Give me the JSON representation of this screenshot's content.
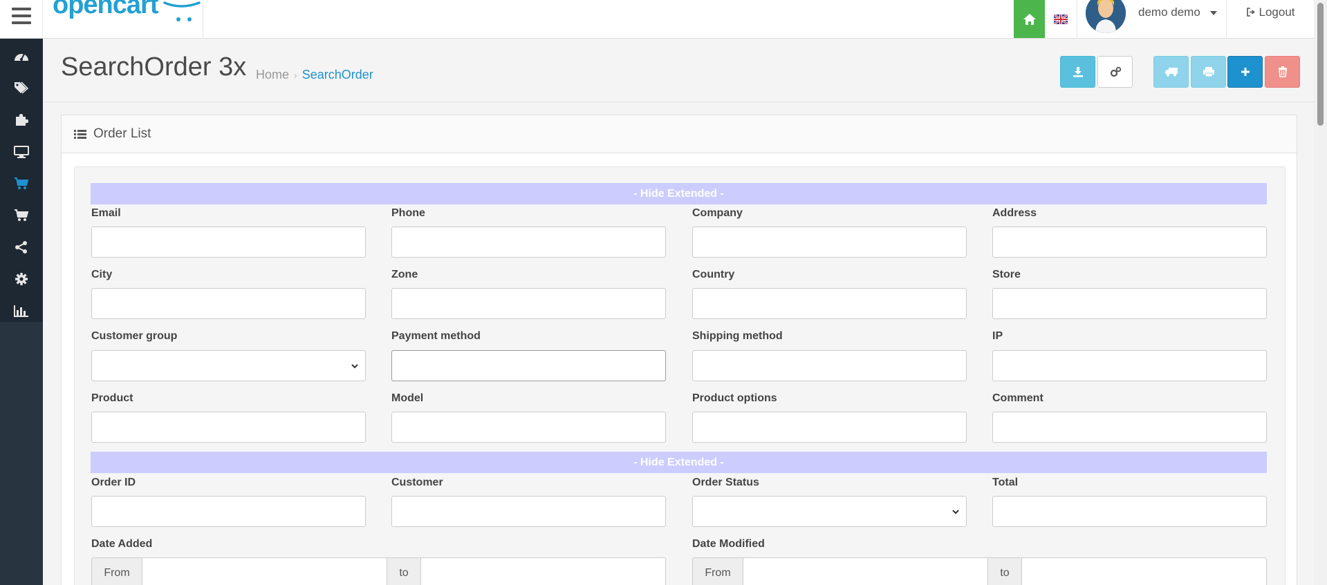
{
  "header": {
    "logo_text": "opencart",
    "user_name": "demo demo",
    "logout_label": "Logout"
  },
  "sidebar": {
    "items": [
      {
        "icon": "dashboard-icon"
      },
      {
        "icon": "tags-icon"
      },
      {
        "icon": "puzzle-icon"
      },
      {
        "icon": "desktop-icon"
      },
      {
        "icon": "shopping-cart-icon"
      },
      {
        "icon": "cart-plus-icon"
      },
      {
        "icon": "share-icon"
      },
      {
        "icon": "cog-icon"
      },
      {
        "icon": "bar-chart-icon"
      }
    ]
  },
  "page": {
    "title": "SearchOrder 3x",
    "breadcrumb_home": "Home",
    "breadcrumb_separator": "›",
    "breadcrumb_current": "SearchOrder"
  },
  "toolbar": {
    "buttons": [
      {
        "icon": "download-icon",
        "color": "#5bc0de"
      },
      {
        "icon": "cogs-icon",
        "color": "#ffffff"
      },
      {
        "icon": "truck-icon",
        "color": "#8fd4ea"
      },
      {
        "icon": "print-icon",
        "color": "#8fd4ea"
      },
      {
        "icon": "plus-icon",
        "color": "#1e91cf"
      },
      {
        "icon": "trash-icon",
        "color": "#f0908a"
      }
    ]
  },
  "panel": {
    "title": "Order List",
    "hide_extended_label": "- Hide Extended -"
  },
  "extended_fields": {
    "email": "Email",
    "phone": "Phone",
    "company": "Company",
    "address": "Address",
    "city": "City",
    "zone": "Zone",
    "country": "Country",
    "store": "Store",
    "customer_group": "Customer group",
    "payment_method": "Payment method",
    "shipping_method": "Shipping method",
    "ip": "IP",
    "product": "Product",
    "model": "Model",
    "product_options": "Product options",
    "comment": "Comment"
  },
  "main_fields": {
    "order_id": "Order ID",
    "customer": "Customer",
    "order_status": "Order Status",
    "total": "Total",
    "date_added": "Date Added",
    "date_modified": "Date Modified",
    "from": "From",
    "to": "to"
  },
  "colors": {
    "brand": "#23a1d1",
    "home_green": "#4cb64c",
    "sidebar_bg": "#293441",
    "extended_bar": "#ccccff"
  }
}
